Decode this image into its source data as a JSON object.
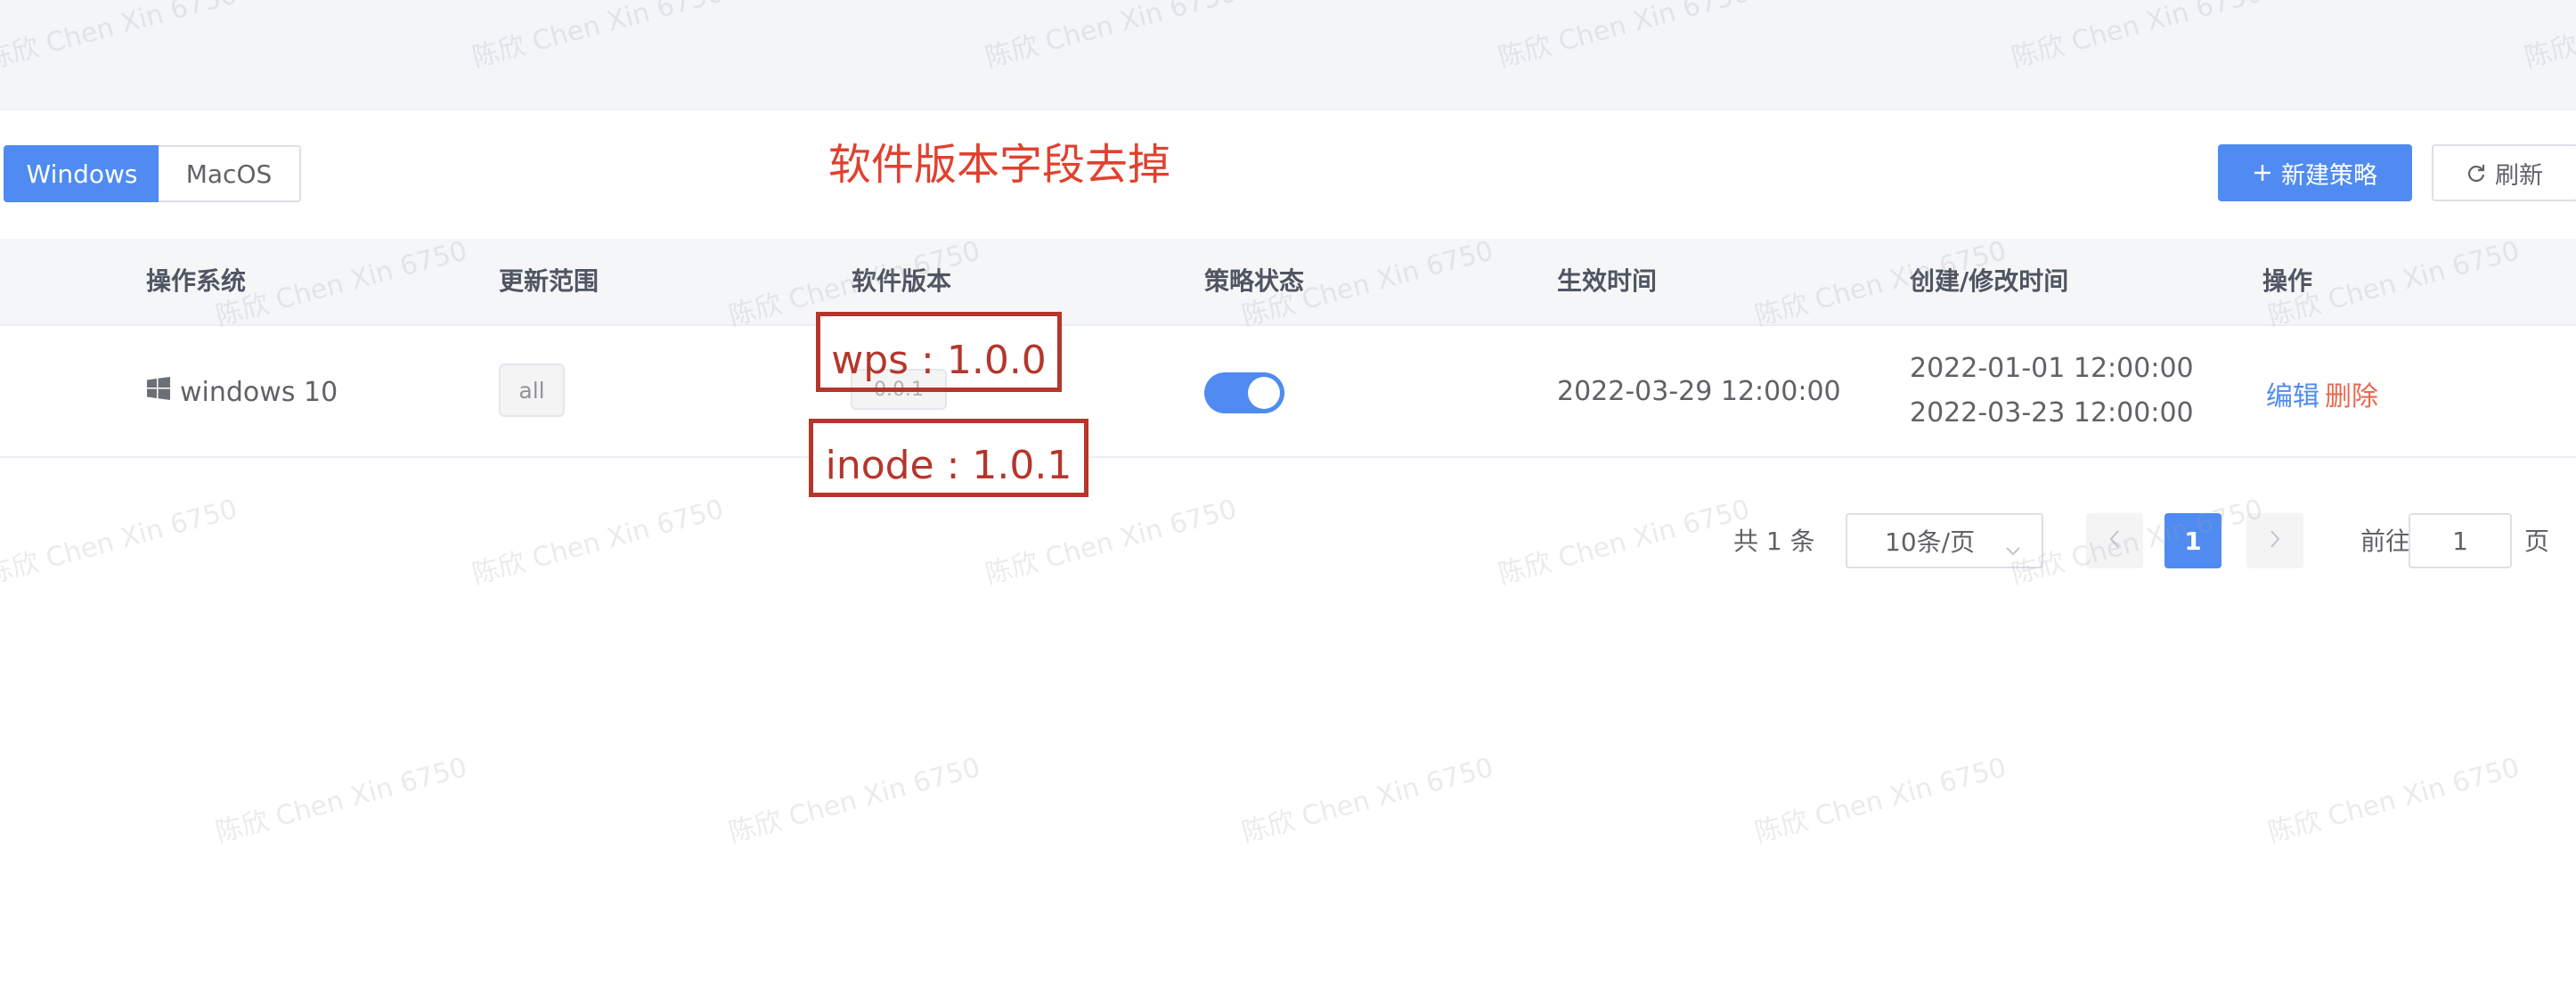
{
  "os_tabs": [
    {
      "label": "Windows",
      "active": true
    },
    {
      "label": "MacOS",
      "active": false
    }
  ],
  "annotation": {
    "title": "软件版本字段去掉",
    "boxes": [
      "wps : 1.0.0",
      "inode : 1.0.1"
    ]
  },
  "toolbar": {
    "new_label": "新建策略",
    "refresh_label": "刷新"
  },
  "table": {
    "columns": [
      "操作系统",
      "更新范围",
      "软件版本",
      "策略状态",
      "生效时间",
      "创建/修改时间",
      "操作"
    ],
    "rows": [
      {
        "os": "windows 10",
        "scope": "all",
        "version": "0.0.1",
        "status_on": true,
        "effective_time": "2022-03-29 12:00:00",
        "created": "2022-01-01 12:00:00",
        "modified": "2022-03-23 12:00:00",
        "actions": {
          "edit": "编辑",
          "delete": "删除"
        }
      }
    ]
  },
  "pagination": {
    "total": "共 1 条",
    "page_size": "10条/页",
    "current_page": "1",
    "goto_prefix": "前往",
    "goto_value": "1",
    "goto_suffix": "页"
  },
  "watermark": "陈欣 Chen Xin 6750",
  "colors": {
    "primary": "#4f8bf0",
    "danger": "#e86a4f",
    "annotation_red": "#b5362b",
    "annotation_title": "#e0412f"
  }
}
